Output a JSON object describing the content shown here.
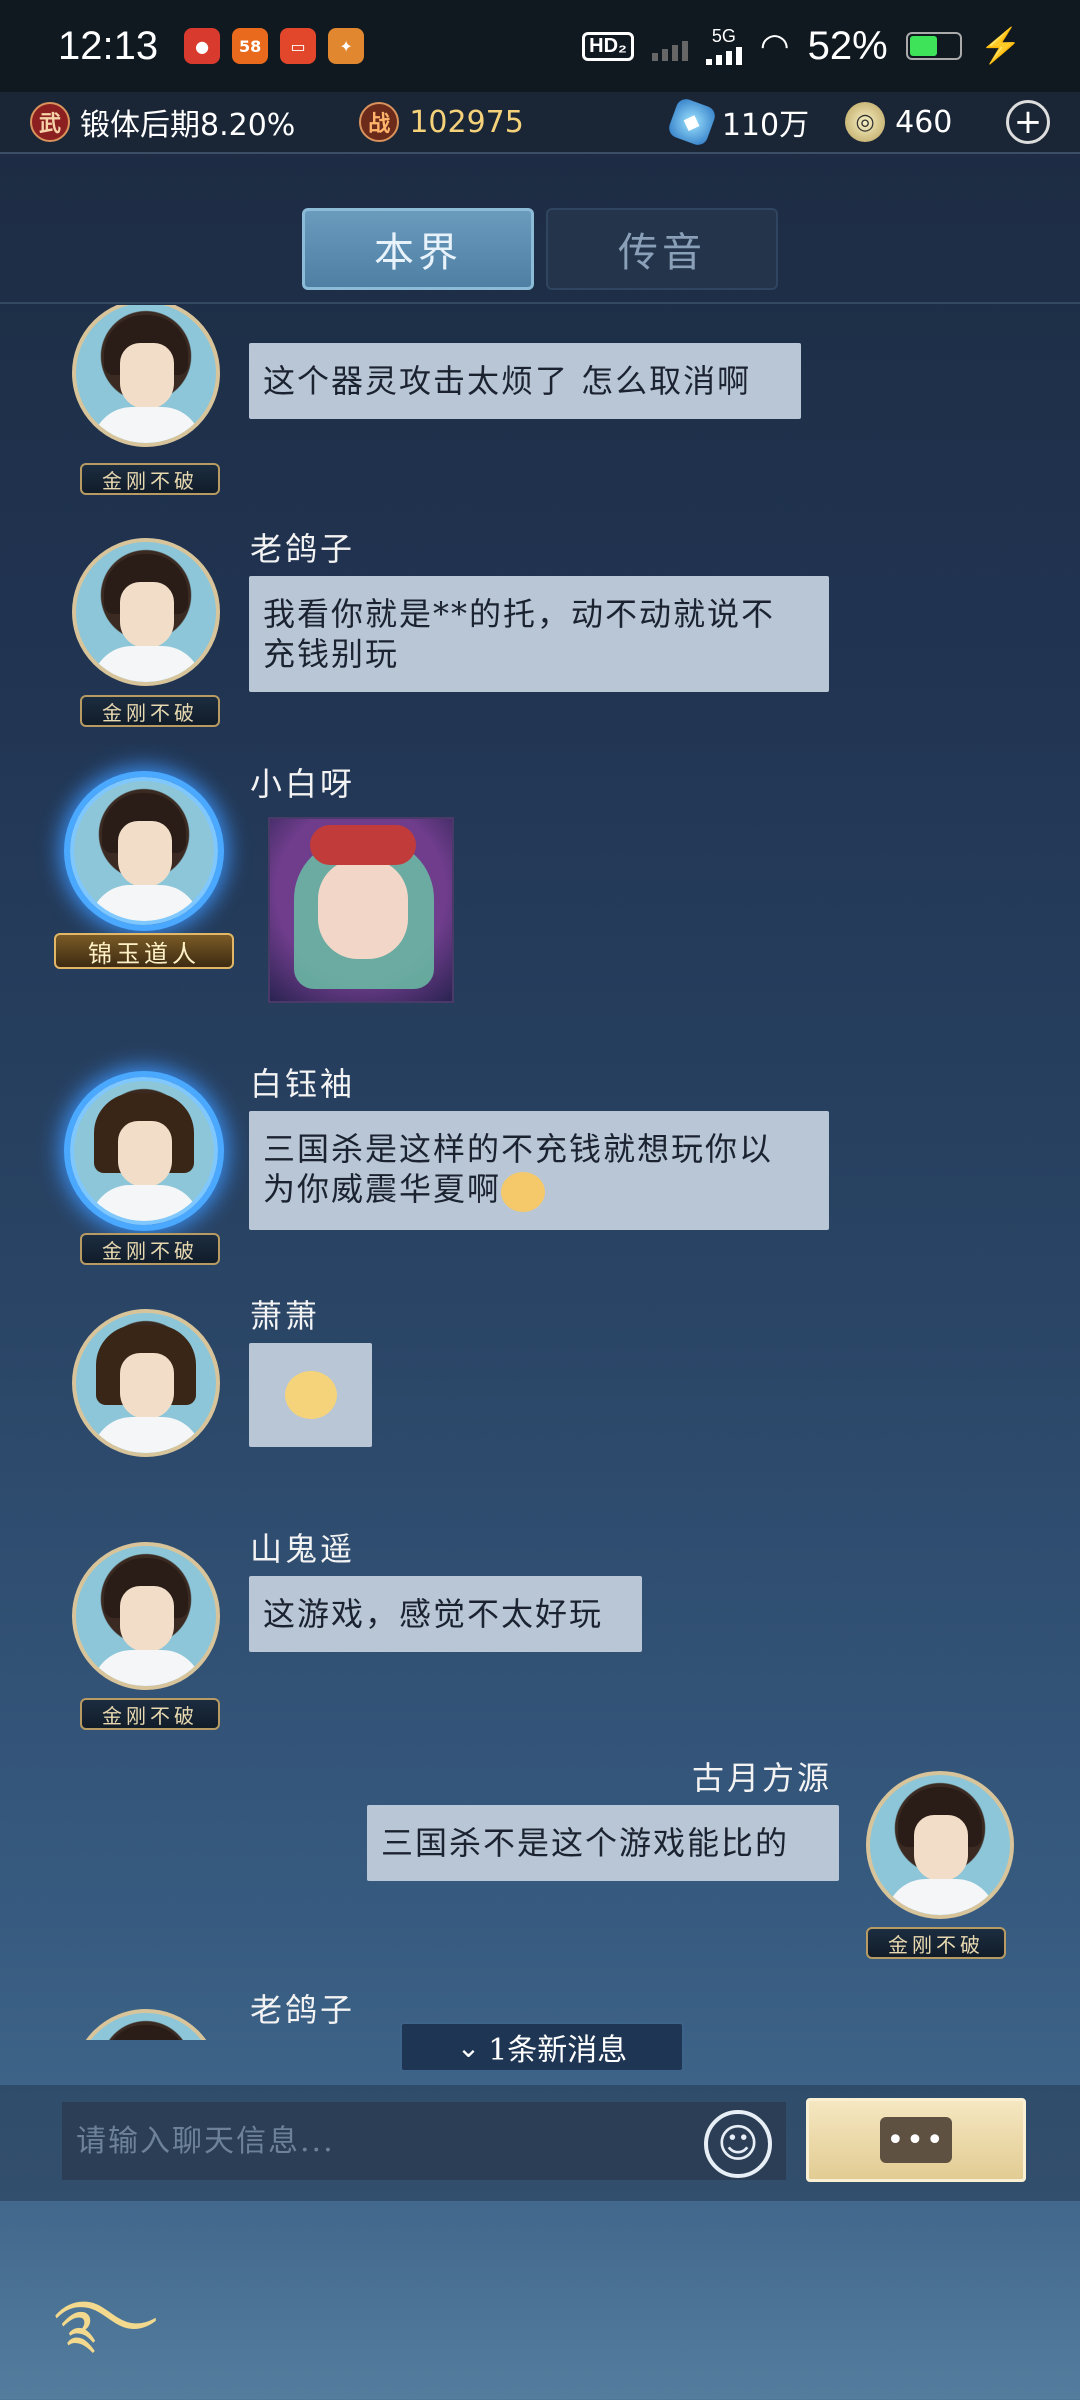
{
  "status_bar": {
    "time": "12:13",
    "notifications": [
      "app-red",
      "app-58",
      "app-orange",
      "app-game"
    ],
    "hd": "HD₂",
    "network": "5G",
    "battery": "52%",
    "battery_level": 0.52
  },
  "resources": {
    "cultivation": "锻体后期8.20%",
    "combat_power": "102975",
    "spirit_stones": "110万",
    "coins": "460",
    "wu_badge": "武",
    "zhan_badge": "战"
  },
  "tabs": [
    {
      "label": "本界",
      "active": true
    },
    {
      "label": "传音",
      "active": false
    }
  ],
  "messages": [
    {
      "sender": "",
      "title": "金刚不破",
      "text": "这个器灵攻击太烦了 怎么取消啊"
    },
    {
      "sender": "老鸽子",
      "title": "金刚不破",
      "text_line1": "我看你就是**的托，动不动就说不",
      "text_line2": "充钱别玩"
    },
    {
      "sender": "小白呀",
      "title": "锦玉道人",
      "type": "sticker"
    },
    {
      "sender": "白钰袖",
      "title": "金刚不破",
      "text_line1": "三国杀是这样的不充钱就想玩你以",
      "text_line2": "为你威震华夏啊"
    },
    {
      "sender": "萧萧",
      "title": "",
      "type": "emoji"
    },
    {
      "sender": "山鬼遥",
      "title": "金刚不破",
      "text": "这游戏，感觉不太好玩"
    },
    {
      "sender": "古月方源",
      "title": "金刚不破",
      "text": "三国杀不是这个游戏能比的",
      "self": true
    },
    {
      "sender": "老鸽子",
      "title": "",
      "text": ""
    }
  ],
  "new_message_pill": "1条新消息",
  "input": {
    "placeholder": "请输入聊天信息..."
  },
  "send_button_glyph": "•••"
}
